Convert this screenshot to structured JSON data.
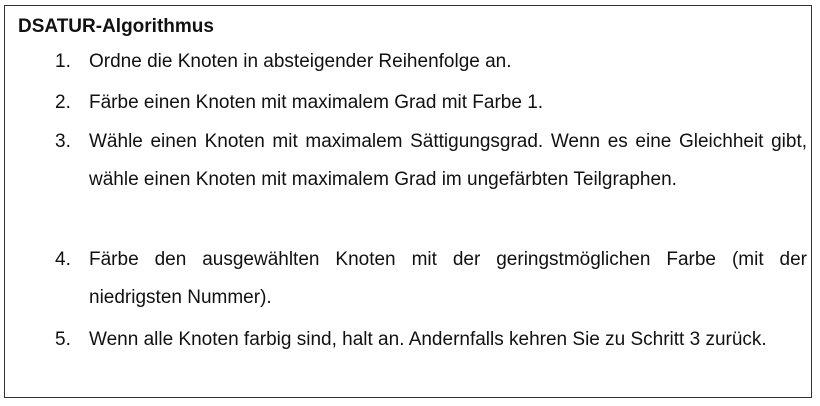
{
  "document": {
    "title": "DSATUR-Algorithmus",
    "steps": [
      {
        "number": "1.",
        "text": "Ordne die Knoten in absteigender Reihenfolge an."
      },
      {
        "number": "2.",
        "text": "Färbe einen Knoten mit maximalem Grad mit Farbe 1."
      },
      {
        "number": "3.",
        "text": "Wähle einen Knoten mit maximalem Sättigungsgrad. Wenn es eine Gleichheit gibt, wähle einen Knoten mit maximalem Grad im ungefärbten Teilgraphen."
      },
      {
        "number": "4.",
        "text": "Färbe den ausgewählten Knoten mit der geringstmöglichen Farbe (mit der niedrigsten Nummer)."
      },
      {
        "number": "5.",
        "text": "Wenn alle Knoten farbig sind, halt an. Andernfalls kehren Sie zu Schritt 3 zurück."
      }
    ]
  }
}
